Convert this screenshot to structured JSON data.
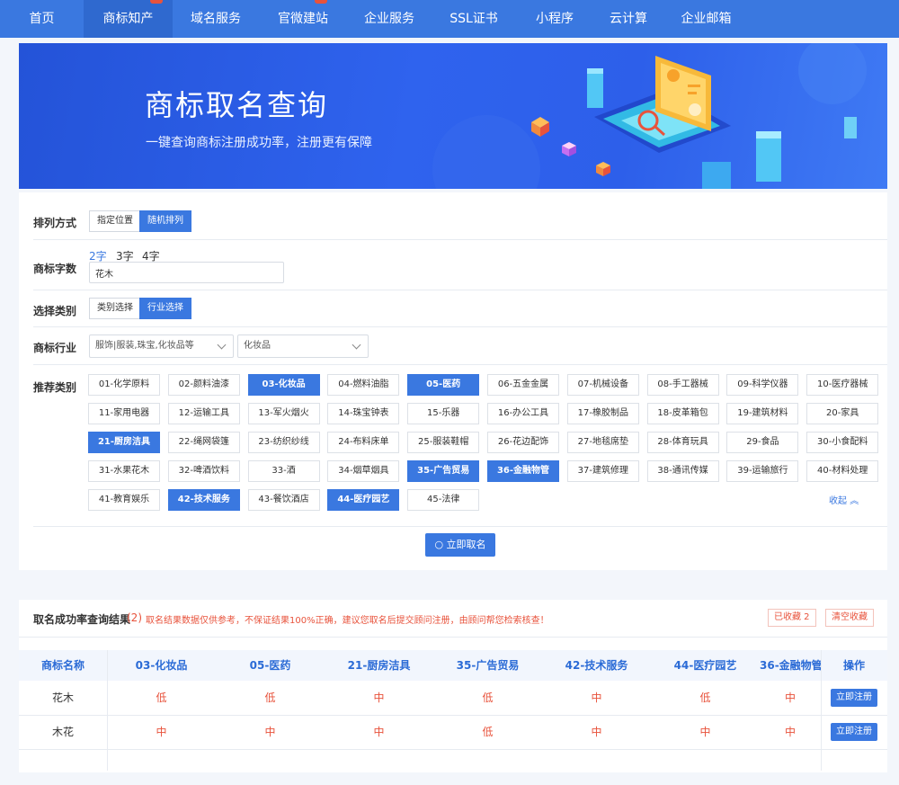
{
  "nav": {
    "items": [
      {
        "label": "首页"
      },
      {
        "label": "商标知产"
      },
      {
        "label": "域名服务"
      },
      {
        "label": "官微建站"
      },
      {
        "label": "企业服务"
      },
      {
        "label": "SSL证书"
      },
      {
        "label": "小程序"
      },
      {
        "label": "云计算"
      },
      {
        "label": "企业邮箱"
      }
    ],
    "active_index": 1
  },
  "banner": {
    "title": "商标取名查询",
    "subtitle": "一键查询商标注册成功率，注册更有保障"
  },
  "form": {
    "sort": {
      "label": "排列方式",
      "options": [
        "指定位置",
        "随机排列"
      ],
      "selected": "随机排列"
    },
    "length": {
      "label": "商标字数",
      "options": [
        "2字",
        "3字",
        "4字"
      ],
      "selected": "2字",
      "value": "花木"
    },
    "category_mode": {
      "label": "选择类别",
      "options": [
        "类别选择",
        "行业选择"
      ],
      "selected": "行业选择"
    },
    "industry": {
      "label": "商标行业",
      "select1": "服饰|服装,珠宝,化妆品等",
      "select2": "化妆品"
    },
    "recommend": {
      "label": "推荐类别",
      "categories": [
        {
          "label": "01-化学原料",
          "selected": false
        },
        {
          "label": "02-颜料油漆",
          "selected": false
        },
        {
          "label": "03-化妆品",
          "selected": true
        },
        {
          "label": "04-燃料油脂",
          "selected": false
        },
        {
          "label": "05-医药",
          "selected": true
        },
        {
          "label": "06-五金金属",
          "selected": false
        },
        {
          "label": "07-机械设备",
          "selected": false
        },
        {
          "label": "08-手工器械",
          "selected": false
        },
        {
          "label": "09-科学仪器",
          "selected": false
        },
        {
          "label": "10-医疗器械",
          "selected": false
        },
        {
          "label": "11-家用电器",
          "selected": false
        },
        {
          "label": "12-运输工具",
          "selected": false
        },
        {
          "label": "13-军火烟火",
          "selected": false
        },
        {
          "label": "14-珠宝钟表",
          "selected": false
        },
        {
          "label": "15-乐器",
          "selected": false
        },
        {
          "label": "16-办公工具",
          "selected": false
        },
        {
          "label": "17-橡胶制品",
          "selected": false
        },
        {
          "label": "18-皮革箱包",
          "selected": false
        },
        {
          "label": "19-建筑材料",
          "selected": false
        },
        {
          "label": "20-家具",
          "selected": false
        },
        {
          "label": "21-厨房洁具",
          "selected": true
        },
        {
          "label": "22-绳网袋篷",
          "selected": false
        },
        {
          "label": "23-纺织纱线",
          "selected": false
        },
        {
          "label": "24-布料床单",
          "selected": false
        },
        {
          "label": "25-服装鞋帽",
          "selected": false
        },
        {
          "label": "26-花边配饰",
          "selected": false
        },
        {
          "label": "27-地毯席垫",
          "selected": false
        },
        {
          "label": "28-体育玩具",
          "selected": false
        },
        {
          "label": "29-食品",
          "selected": false
        },
        {
          "label": "30-小食配料",
          "selected": false
        },
        {
          "label": "31-水果花木",
          "selected": false
        },
        {
          "label": "32-啤酒饮料",
          "selected": false
        },
        {
          "label": "33-酒",
          "selected": false
        },
        {
          "label": "34-烟草烟具",
          "selected": false
        },
        {
          "label": "35-广告贸易",
          "selected": true
        },
        {
          "label": "36-金融物管",
          "selected": true
        },
        {
          "label": "37-建筑修理",
          "selected": false
        },
        {
          "label": "38-通讯传媒",
          "selected": false
        },
        {
          "label": "39-运输旅行",
          "selected": false
        },
        {
          "label": "40-材料处理",
          "selected": false
        },
        {
          "label": "41-教育娱乐",
          "selected": false
        },
        {
          "label": "42-技术服务",
          "selected": true
        },
        {
          "label": "43-餐饮酒店",
          "selected": false
        },
        {
          "label": "44-医疗园艺",
          "selected": true
        },
        {
          "label": "45-法律",
          "selected": false
        }
      ],
      "collapse_label": "收起"
    },
    "search_button": "立即取名"
  },
  "results": {
    "title": "取名成功率查询结果",
    "count": "(2)",
    "note": "取名结果数据仅供参考，不保证结果100%正确，建议您取名后提交顾问注册，由顾问帮您检索核查！",
    "favorites_label": "已收藏 2",
    "clear_label": "清空收藏",
    "columns": [
      "商标名称",
      "03-化妆品",
      "05-医药",
      "21-厨房洁具",
      "35-广告贸易",
      "42-技术服务",
      "44-医疗园艺",
      "36-金融物管",
      "操作"
    ],
    "rows": [
      {
        "name": "花木",
        "values": [
          "低",
          "低",
          "中",
          "低",
          "中",
          "低",
          "中"
        ],
        "action": "立即注册"
      },
      {
        "name": "木花",
        "values": [
          "中",
          "中",
          "中",
          "低",
          "中",
          "中",
          "中"
        ],
        "action": "立即注册"
      }
    ]
  },
  "colors": {
    "primary": "#3a78e0",
    "warn": "#e8533c"
  }
}
